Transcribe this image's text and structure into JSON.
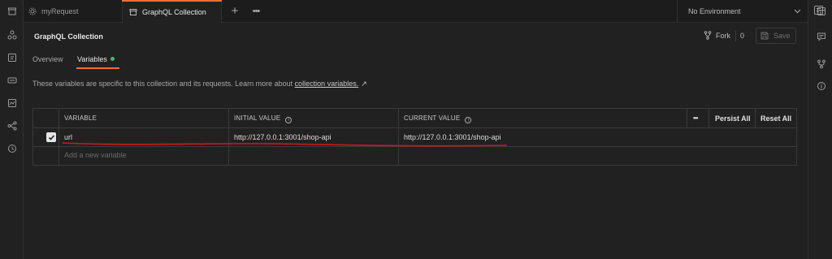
{
  "tabs": {
    "request_label": "myRequest",
    "collection_label": "GraphQL Collection",
    "new_tab": "+",
    "more": "•••"
  },
  "environment": {
    "selected": "No Environment"
  },
  "header": {
    "title": "GraphQL Collection",
    "fork_label": "Fork",
    "fork_count": "0",
    "save_label": "Save"
  },
  "subtabs": {
    "overview": "Overview",
    "variables": "Variables"
  },
  "info": {
    "text": "These variables are specific to this collection and its requests. Learn more about ",
    "link": "collection variables.",
    "arrow": "↗"
  },
  "table": {
    "headers": {
      "variable": "VARIABLE",
      "initial": "INITIAL VALUE",
      "current": "CURRENT VALUE",
      "more": "•••",
      "persist_all": "Persist All",
      "reset_all": "Reset All"
    },
    "rows": [
      {
        "checked": true,
        "variable": "url",
        "initial": "http://127.0.0.1:3001/shop-api",
        "current": "http://127.0.0.1:3001/shop-api"
      }
    ],
    "placeholder": "Add a new variable"
  },
  "colors": {
    "accent": "#ff6c37",
    "dot": "#3fbe6c",
    "annotation": "#d0181b"
  }
}
